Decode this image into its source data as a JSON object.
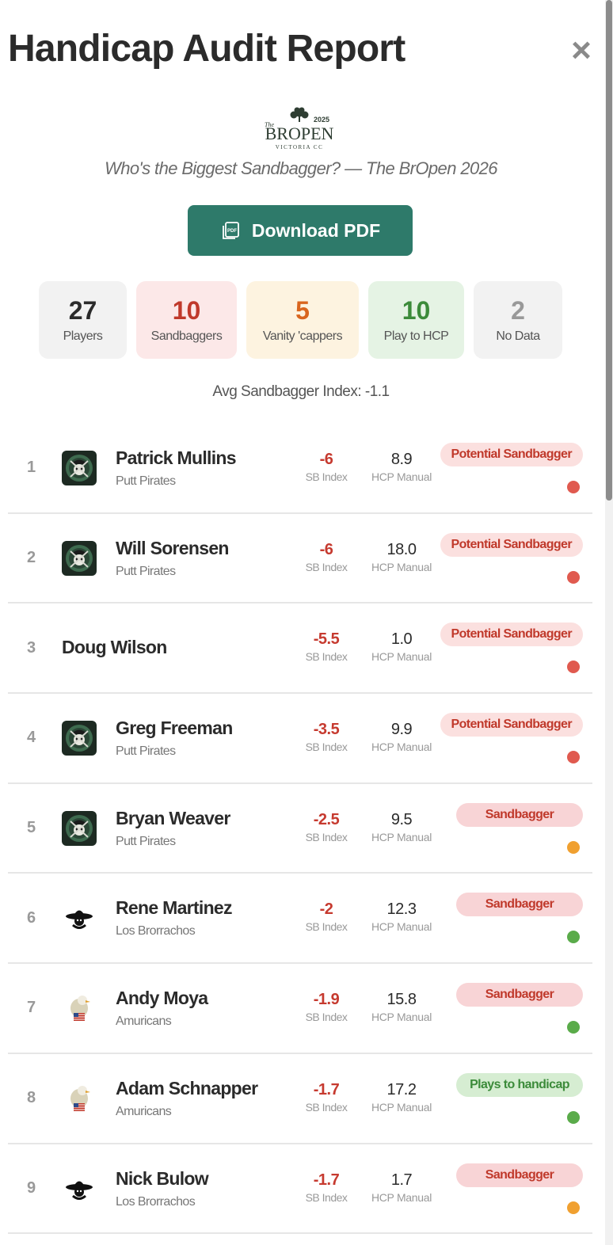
{
  "header": {
    "title": "Handicap Audit Report",
    "close_label": "×"
  },
  "subtitle": "Who's the Biggest Sandbagger? — The BrOpen 2026",
  "logo": {
    "top_text": "2025",
    "main_text": "BROPEN",
    "prefix": "The",
    "bottom_text": "VICTORIA CC"
  },
  "download": {
    "label": "Download PDF",
    "icon": "pdf-icon"
  },
  "stats": [
    {
      "value": "27",
      "label": "Players",
      "bg": "#f2f2f2",
      "color": "#2b2b2b",
      "width": 111
    },
    {
      "value": "10",
      "label": "Sandbaggers",
      "bg": "#fce8e8",
      "color": "#c0392b",
      "width": 127
    },
    {
      "value": "5",
      "label": "Vanity 'cappers",
      "bg": "#fdf3e0",
      "color": "#d9651e",
      "width": 142
    },
    {
      "value": "10",
      "label": "Play to HCP",
      "bg": "#e5f3e4",
      "color": "#3c8b3a",
      "width": 121
    },
    {
      "value": "2",
      "label": "No Data",
      "bg": "#f2f2f2",
      "color": "#999999",
      "width": 112
    }
  ],
  "avg_text": "Avg Sandbagger Index: -1.1",
  "labels": {
    "sb": "SB Index",
    "hcp": "HCP",
    "manual": "Manual"
  },
  "players": [
    {
      "rank": "1",
      "name": "Patrick Mullins",
      "team": "Putt Pirates",
      "avatar": "pirate",
      "sb": "-6",
      "hcp": "8.9",
      "badge": "Potential Sandbagger",
      "badge_type": "potential",
      "dot": "#e05a4f"
    },
    {
      "rank": "2",
      "name": "Will Sorensen",
      "team": "Putt Pirates",
      "avatar": "pirate",
      "sb": "-6",
      "hcp": "18.0",
      "badge": "Potential Sandbagger",
      "badge_type": "potential",
      "dot": "#e05a4f"
    },
    {
      "rank": "3",
      "name": "Doug Wilson",
      "team": "",
      "avatar": "",
      "sb": "-5.5",
      "hcp": "1.0",
      "badge": "Potential Sandbagger",
      "badge_type": "potential",
      "dot": "#e05a4f"
    },
    {
      "rank": "4",
      "name": "Greg Freeman",
      "team": "Putt Pirates",
      "avatar": "pirate",
      "sb": "-3.5",
      "hcp": "9.9",
      "badge": "Potential Sandbagger",
      "badge_type": "potential",
      "dot": "#e05a4f"
    },
    {
      "rank": "5",
      "name": "Bryan Weaver",
      "team": "Putt Pirates",
      "avatar": "pirate",
      "sb": "-2.5",
      "hcp": "9.5",
      "badge": "Sandbagger",
      "badge_type": "sandbagger",
      "dot": "#f0a030"
    },
    {
      "rank": "6",
      "name": "Rene Martinez",
      "team": "Los Brorrachos",
      "avatar": "sombrero",
      "sb": "-2",
      "hcp": "12.3",
      "badge": "Sandbagger",
      "badge_type": "sandbagger",
      "dot": "#5aab4a"
    },
    {
      "rank": "7",
      "name": "Andy Moya",
      "team": "Amuricans",
      "avatar": "eagle",
      "sb": "-1.9",
      "hcp": "15.8",
      "badge": "Sandbagger",
      "badge_type": "sandbagger",
      "dot": "#5aab4a"
    },
    {
      "rank": "8",
      "name": "Adam Schnapper",
      "team": "Amuricans",
      "avatar": "eagle",
      "sb": "-1.7",
      "hcp": "17.2",
      "badge": "Plays to handicap",
      "badge_type": "plays",
      "dot": "#5aab4a"
    },
    {
      "rank": "9",
      "name": "Nick Bulow",
      "team": "Los Brorrachos",
      "avatar": "sombrero",
      "sb": "-1.7",
      "hcp": "1.7",
      "badge": "Sandbagger",
      "badge_type": "sandbagger",
      "dot": "#f0a030"
    }
  ]
}
